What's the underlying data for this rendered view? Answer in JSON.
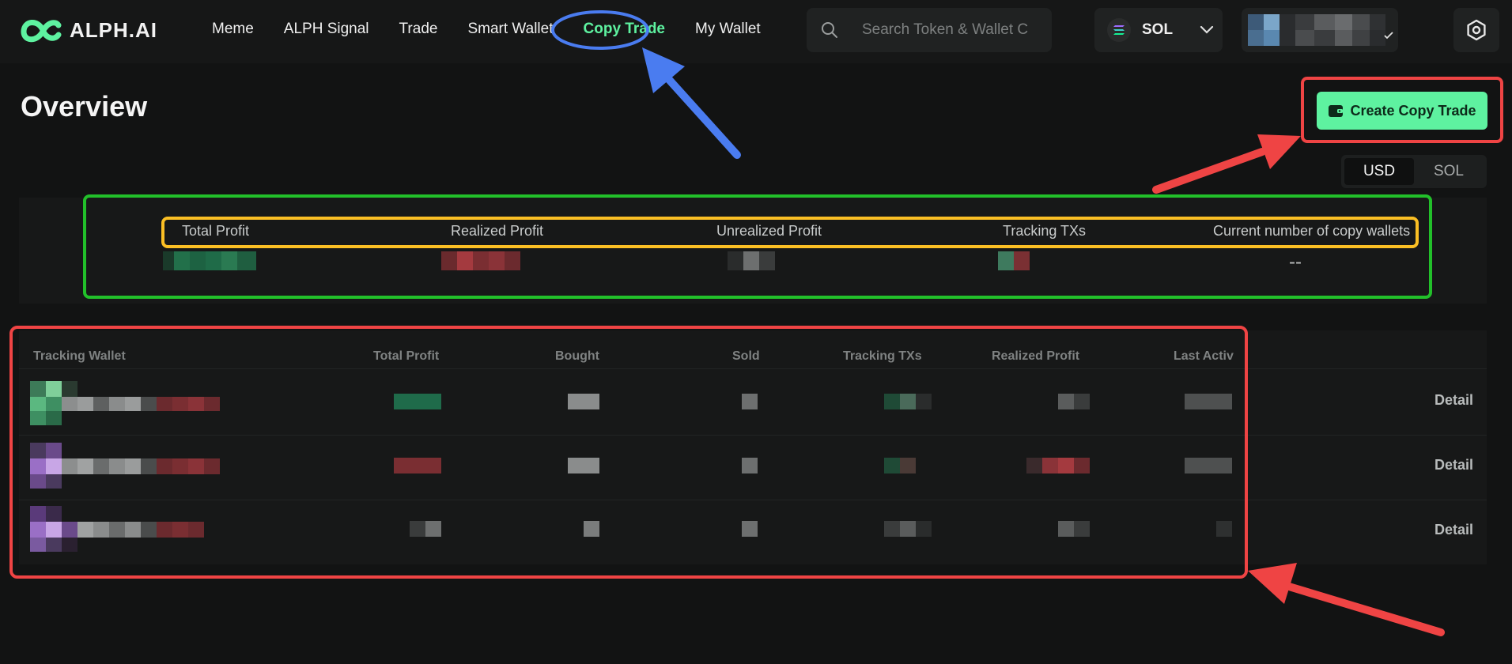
{
  "brand": {
    "name": "ALPH.AI"
  },
  "nav": {
    "items": [
      {
        "label": "Meme",
        "active": false
      },
      {
        "label": "ALPH Signal",
        "active": false
      },
      {
        "label": "Trade",
        "active": false
      },
      {
        "label": "Smart Wallet",
        "active": false
      },
      {
        "label": "Copy Trade",
        "active": true
      },
      {
        "label": "My Wallet",
        "active": false
      }
    ]
  },
  "search": {
    "placeholder": "Search Token & Wallet C"
  },
  "chain": {
    "label": "SOL"
  },
  "page": {
    "title": "Overview"
  },
  "actions": {
    "create_label": "Create Copy Trade"
  },
  "currency_toggle": {
    "options": [
      "USD",
      "SOL"
    ],
    "selected": "USD"
  },
  "summary": {
    "labels": [
      "Total Profit",
      "Realized Profit",
      "Unrealized Profit",
      "Tracking TXs",
      "Current number of copy wallets"
    ],
    "copy_wallets_value": "--"
  },
  "table": {
    "headers": [
      "Tracking Wallet",
      "Total Profit",
      "Bought",
      "Sold",
      "Tracking TXs",
      "Realized Profit",
      "Last Activ"
    ],
    "rows": [
      {
        "action": "Detail"
      },
      {
        "action": "Detail"
      },
      {
        "action": "Detail"
      }
    ]
  },
  "colors": {
    "accent": "#5ef2a0",
    "profit": "#1f6b4a",
    "loss": "#8a2f33",
    "annotation_red": "#ef4444",
    "annotation_blue": "#4a7cf0",
    "annotation_green": "#22c02a",
    "annotation_yellow": "#fbbf24"
  }
}
